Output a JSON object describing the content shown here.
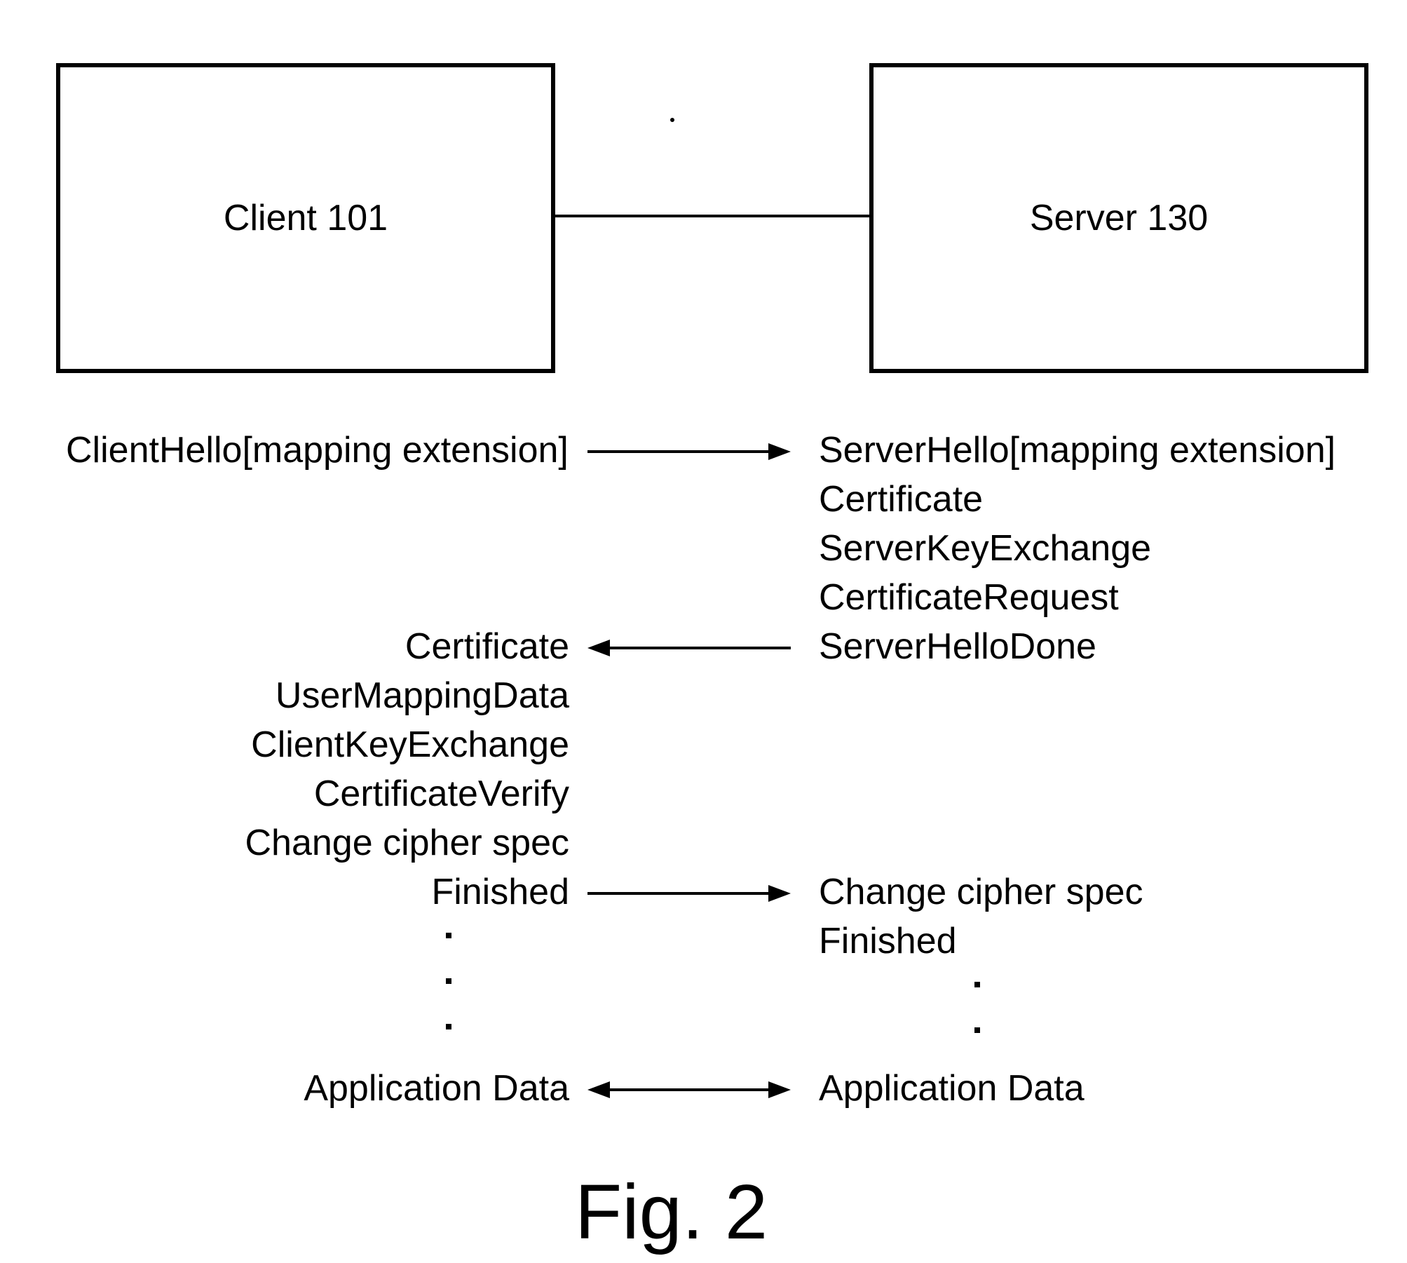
{
  "boxes": {
    "client": "Client 101",
    "server": "Server 130"
  },
  "client_msgs": {
    "hello": "ClientHello[mapping extension]",
    "certificate": "Certificate",
    "user_mapping": "UserMappingData",
    "key_exchange": "ClientKeyExchange",
    "cert_verify": "CertificateVerify",
    "change_cipher": "Change cipher spec",
    "finished": "Finished",
    "app_data": "Application Data"
  },
  "server_msgs": {
    "hello": "ServerHello[mapping extension]",
    "certificate": "Certificate",
    "key_exchange": "ServerKeyExchange",
    "cert_request": "CertificateRequest",
    "hello_done": "ServerHelloDone",
    "change_cipher": "Change cipher spec",
    "finished": "Finished",
    "app_data": "Application Data"
  },
  "figure_caption": "Fig. 2"
}
